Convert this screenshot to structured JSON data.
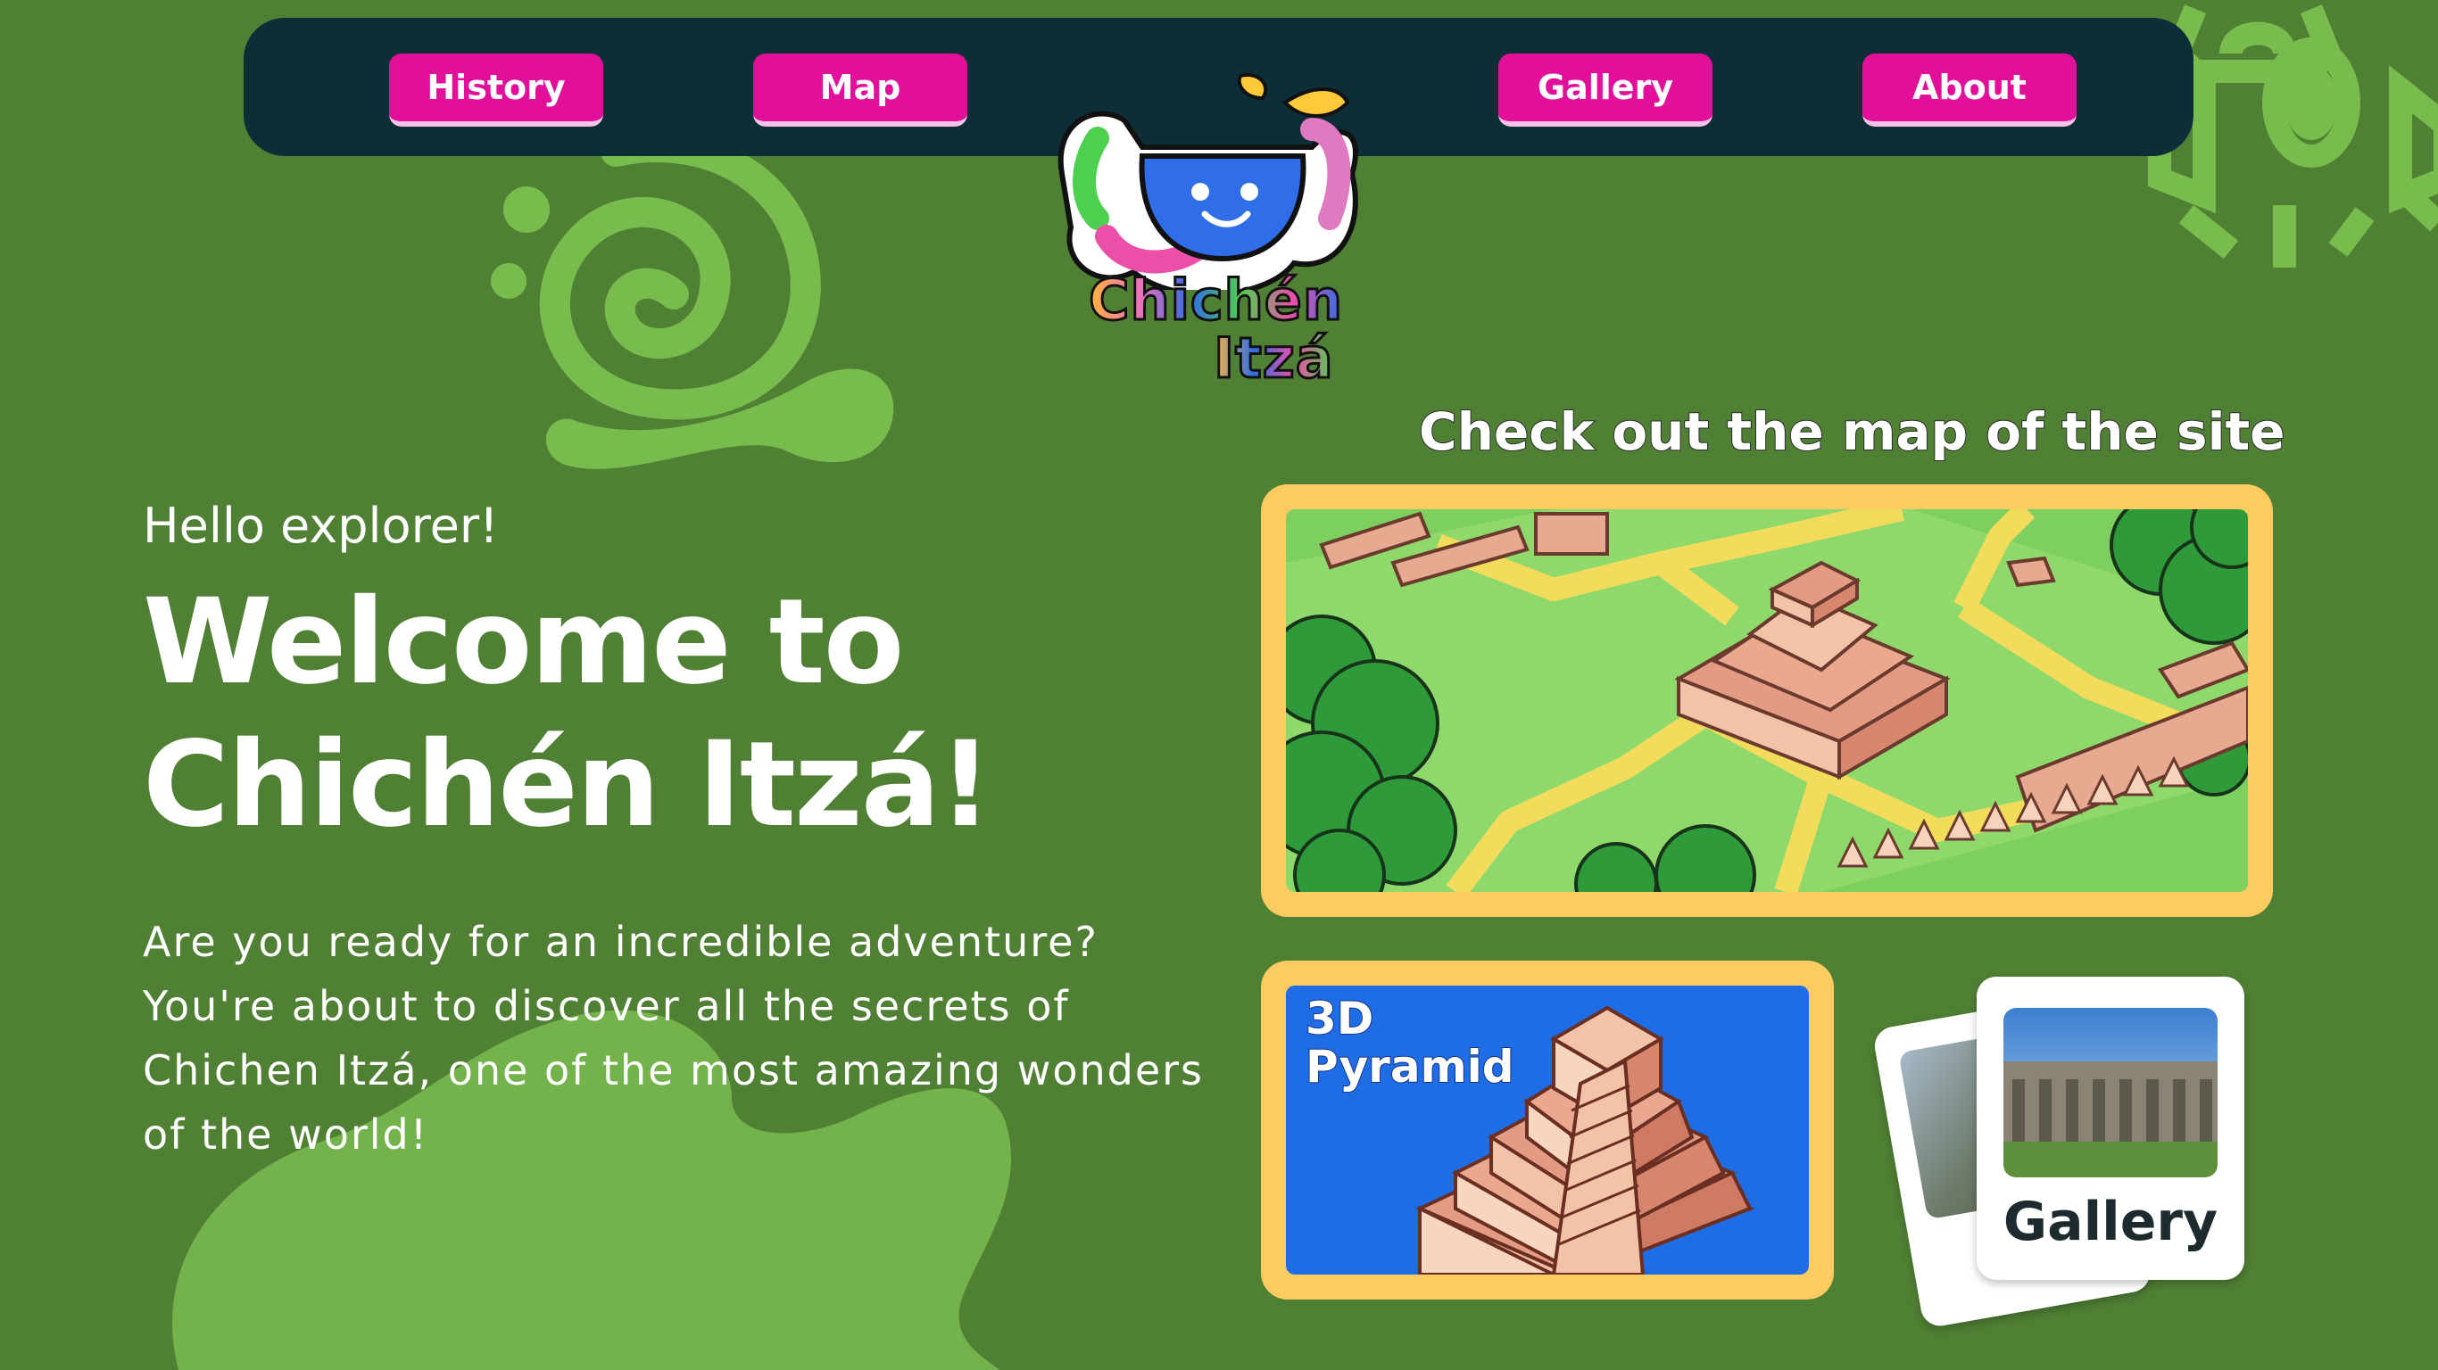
{
  "nav": {
    "items": [
      {
        "label": "History"
      },
      {
        "label": "Map"
      },
      {
        "label": "Gallery"
      },
      {
        "label": "About"
      }
    ]
  },
  "logo": {
    "line1": "Chichén",
    "line2": "Itzá"
  },
  "hero": {
    "greeting": "Hello explorer!",
    "title_line1": "Welcome to",
    "title_line2": "Chichén Itzá!",
    "intro": "Are you ready for an incredible adventure? You're about to discover all the secrets of Chichen Itzá, one of the most amazing wonders of the world!"
  },
  "map_section": {
    "heading": "Check out the map of the site"
  },
  "pyramid_card": {
    "line1": "3D",
    "line2": "Pyramid"
  },
  "gallery_card": {
    "label": "Gallery"
  },
  "colors": {
    "background": "#508034",
    "navbar": "#0d2e36",
    "nav_button": "#e10f9a",
    "card_frame": "#fdcb5f",
    "pyramid_bg": "#1f6de4",
    "decor_green": "#78bc4e"
  }
}
